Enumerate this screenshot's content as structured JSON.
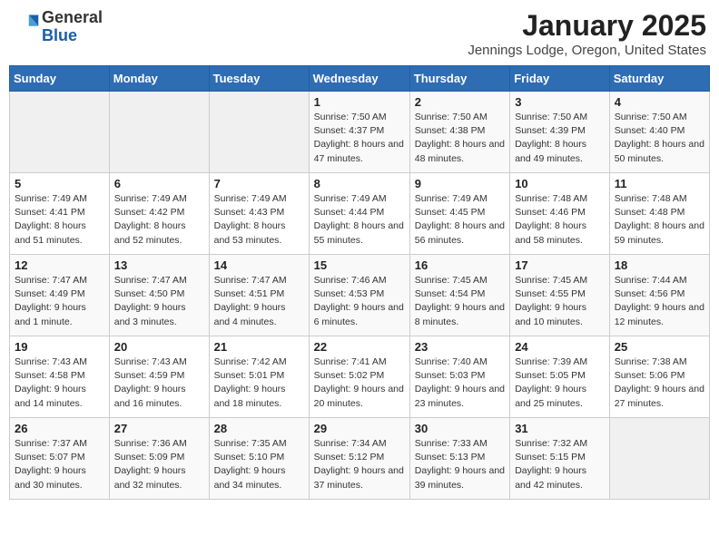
{
  "header": {
    "logo_general": "General",
    "logo_blue": "Blue",
    "month": "January 2025",
    "location": "Jennings Lodge, Oregon, United States"
  },
  "weekdays": [
    "Sunday",
    "Monday",
    "Tuesday",
    "Wednesday",
    "Thursday",
    "Friday",
    "Saturday"
  ],
  "weeks": [
    [
      {
        "day": "",
        "info": ""
      },
      {
        "day": "",
        "info": ""
      },
      {
        "day": "",
        "info": ""
      },
      {
        "day": "1",
        "info": "Sunrise: 7:50 AM\nSunset: 4:37 PM\nDaylight: 8 hours and 47 minutes."
      },
      {
        "day": "2",
        "info": "Sunrise: 7:50 AM\nSunset: 4:38 PM\nDaylight: 8 hours and 48 minutes."
      },
      {
        "day": "3",
        "info": "Sunrise: 7:50 AM\nSunset: 4:39 PM\nDaylight: 8 hours and 49 minutes."
      },
      {
        "day": "4",
        "info": "Sunrise: 7:50 AM\nSunset: 4:40 PM\nDaylight: 8 hours and 50 minutes."
      }
    ],
    [
      {
        "day": "5",
        "info": "Sunrise: 7:49 AM\nSunset: 4:41 PM\nDaylight: 8 hours and 51 minutes."
      },
      {
        "day": "6",
        "info": "Sunrise: 7:49 AM\nSunset: 4:42 PM\nDaylight: 8 hours and 52 minutes."
      },
      {
        "day": "7",
        "info": "Sunrise: 7:49 AM\nSunset: 4:43 PM\nDaylight: 8 hours and 53 minutes."
      },
      {
        "day": "8",
        "info": "Sunrise: 7:49 AM\nSunset: 4:44 PM\nDaylight: 8 hours and 55 minutes."
      },
      {
        "day": "9",
        "info": "Sunrise: 7:49 AM\nSunset: 4:45 PM\nDaylight: 8 hours and 56 minutes."
      },
      {
        "day": "10",
        "info": "Sunrise: 7:48 AM\nSunset: 4:46 PM\nDaylight: 8 hours and 58 minutes."
      },
      {
        "day": "11",
        "info": "Sunrise: 7:48 AM\nSunset: 4:48 PM\nDaylight: 8 hours and 59 minutes."
      }
    ],
    [
      {
        "day": "12",
        "info": "Sunrise: 7:47 AM\nSunset: 4:49 PM\nDaylight: 9 hours and 1 minute."
      },
      {
        "day": "13",
        "info": "Sunrise: 7:47 AM\nSunset: 4:50 PM\nDaylight: 9 hours and 3 minutes."
      },
      {
        "day": "14",
        "info": "Sunrise: 7:47 AM\nSunset: 4:51 PM\nDaylight: 9 hours and 4 minutes."
      },
      {
        "day": "15",
        "info": "Sunrise: 7:46 AM\nSunset: 4:53 PM\nDaylight: 9 hours and 6 minutes."
      },
      {
        "day": "16",
        "info": "Sunrise: 7:45 AM\nSunset: 4:54 PM\nDaylight: 9 hours and 8 minutes."
      },
      {
        "day": "17",
        "info": "Sunrise: 7:45 AM\nSunset: 4:55 PM\nDaylight: 9 hours and 10 minutes."
      },
      {
        "day": "18",
        "info": "Sunrise: 7:44 AM\nSunset: 4:56 PM\nDaylight: 9 hours and 12 minutes."
      }
    ],
    [
      {
        "day": "19",
        "info": "Sunrise: 7:43 AM\nSunset: 4:58 PM\nDaylight: 9 hours and 14 minutes."
      },
      {
        "day": "20",
        "info": "Sunrise: 7:43 AM\nSunset: 4:59 PM\nDaylight: 9 hours and 16 minutes."
      },
      {
        "day": "21",
        "info": "Sunrise: 7:42 AM\nSunset: 5:01 PM\nDaylight: 9 hours and 18 minutes."
      },
      {
        "day": "22",
        "info": "Sunrise: 7:41 AM\nSunset: 5:02 PM\nDaylight: 9 hours and 20 minutes."
      },
      {
        "day": "23",
        "info": "Sunrise: 7:40 AM\nSunset: 5:03 PM\nDaylight: 9 hours and 23 minutes."
      },
      {
        "day": "24",
        "info": "Sunrise: 7:39 AM\nSunset: 5:05 PM\nDaylight: 9 hours and 25 minutes."
      },
      {
        "day": "25",
        "info": "Sunrise: 7:38 AM\nSunset: 5:06 PM\nDaylight: 9 hours and 27 minutes."
      }
    ],
    [
      {
        "day": "26",
        "info": "Sunrise: 7:37 AM\nSunset: 5:07 PM\nDaylight: 9 hours and 30 minutes."
      },
      {
        "day": "27",
        "info": "Sunrise: 7:36 AM\nSunset: 5:09 PM\nDaylight: 9 hours and 32 minutes."
      },
      {
        "day": "28",
        "info": "Sunrise: 7:35 AM\nSunset: 5:10 PM\nDaylight: 9 hours and 34 minutes."
      },
      {
        "day": "29",
        "info": "Sunrise: 7:34 AM\nSunset: 5:12 PM\nDaylight: 9 hours and 37 minutes."
      },
      {
        "day": "30",
        "info": "Sunrise: 7:33 AM\nSunset: 5:13 PM\nDaylight: 9 hours and 39 minutes."
      },
      {
        "day": "31",
        "info": "Sunrise: 7:32 AM\nSunset: 5:15 PM\nDaylight: 9 hours and 42 minutes."
      },
      {
        "day": "",
        "info": ""
      }
    ]
  ]
}
